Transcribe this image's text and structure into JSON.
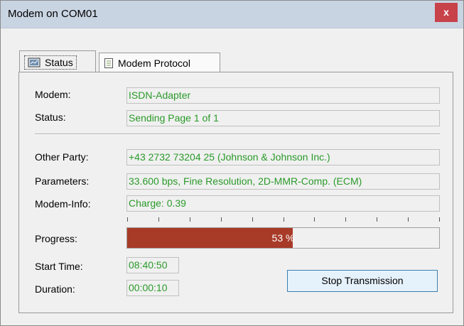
{
  "window": {
    "title": "Modem on COM01",
    "close_glyph": "x"
  },
  "tabs": [
    {
      "label": "Status",
      "icon": "monitor-icon",
      "active": true
    },
    {
      "label": "Modem Protocol",
      "icon": "document-icon",
      "active": false
    }
  ],
  "status": {
    "modem": {
      "label": "Modem:",
      "value": "ISDN-Adapter"
    },
    "status": {
      "label": "Status:",
      "value": "Sending Page 1 of 1"
    },
    "other_party": {
      "label": "Other Party:",
      "value": "+43 2732 73204 25 (Johnson & Johnson Inc.)"
    },
    "parameters": {
      "label": "Parameters:",
      "value": "33.600 bps, Fine Resolution, 2D-MMR-Comp. (ECM)"
    },
    "modem_info": {
      "label": "Modem-Info:",
      "value": "Charge: 0.39"
    },
    "progress": {
      "label": "Progress:",
      "value": 53,
      "text": "53 %"
    },
    "start_time": {
      "label": "Start Time:",
      "value": "08:40:50"
    },
    "duration": {
      "label": "Duration:",
      "value": "00:00:10"
    }
  },
  "buttons": {
    "stop": "Stop Transmission"
  },
  "colors": {
    "titlebar": "#c9d4e2",
    "close": "#c8424a",
    "field_text": "#2a9a2a",
    "progress_fill": "#a83a28"
  }
}
